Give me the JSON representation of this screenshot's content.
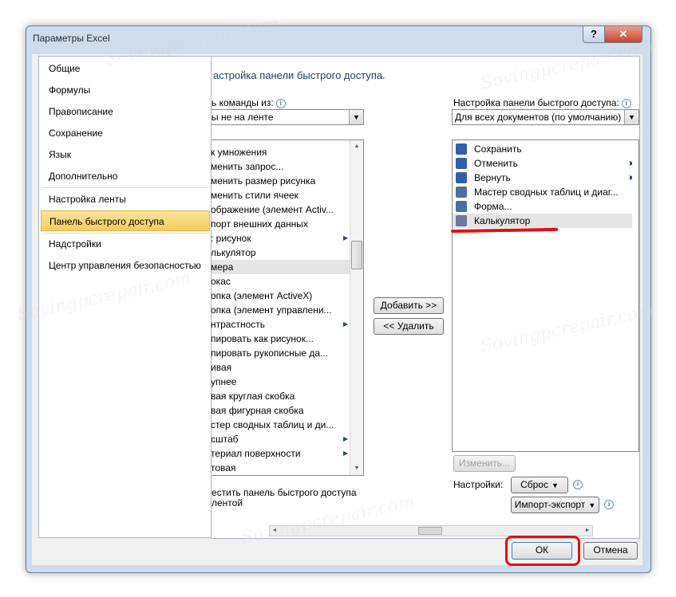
{
  "window": {
    "title": "Параметры Excel",
    "help_label": "?",
    "close_label": "✕"
  },
  "nav": {
    "items": [
      {
        "label": "Общие"
      },
      {
        "label": "Формулы"
      },
      {
        "label": "Правописание"
      },
      {
        "label": "Сохранение"
      },
      {
        "label": "Язык"
      },
      {
        "label": "Дополнительно"
      },
      {
        "label": "Настройка ленты"
      },
      {
        "label": "Панель быстрого доступа",
        "active": true
      },
      {
        "label": "Надстройки"
      },
      {
        "label": "Центр управления безопасностью"
      }
    ]
  },
  "main": {
    "heading": "астройка панели быстрого доступа.",
    "choose_label": "ь команды из:",
    "choose_value": "ы не на ленте",
    "customize_label": "Настройка панели быстрого доступа:",
    "customize_value": "Для всех документов (по умолчанию)",
    "commands": [
      {
        "label": "к умножения"
      },
      {
        "label": "менить запрос..."
      },
      {
        "label": "менить размер рисунка"
      },
      {
        "label": "менить стили ячеек"
      },
      {
        "label": "ображение (элемент Activ..."
      },
      {
        "label": "порт внешних данных"
      },
      {
        "label": ": рисунок",
        "submenu": true
      },
      {
        "label": "лькулятор"
      },
      {
        "label": "мера",
        "selected": true
      },
      {
        "label": "окас"
      },
      {
        "label": "опка (элемент ActiveX)"
      },
      {
        "label": "опка (элемент управлени..."
      },
      {
        "label": "нтрастность",
        "submenu": true
      },
      {
        "label": "пировать как рисунок..."
      },
      {
        "label": "пировать рукописные да..."
      },
      {
        "label": "ивая"
      },
      {
        "label": "упнее"
      },
      {
        "label": "вая круглая скобка"
      },
      {
        "label": "вая фигурная скобка"
      },
      {
        "label": "стер сводных таблиц и ди..."
      },
      {
        "label": "сштаб",
        "submenu": true
      },
      {
        "label": "териал поверхности",
        "submenu": true
      },
      {
        "label": "товая"
      }
    ],
    "qat_items": [
      {
        "label": "Сохранить",
        "icon": "save-icon",
        "color": "#2f5fa8"
      },
      {
        "label": "Отменить",
        "icon": "undo-icon",
        "color": "#2f5fa8",
        "submenu": true
      },
      {
        "label": "Вернуть",
        "icon": "redo-icon",
        "color": "#2f5fa8",
        "submenu": true
      },
      {
        "label": "Мастер сводных таблиц и диаг...",
        "icon": "pivot-wizard-icon",
        "color": "#4a6fa0"
      },
      {
        "label": "Форма...",
        "icon": "form-icon",
        "color": "#4a6fa0"
      },
      {
        "label": "Калькулятор",
        "icon": "calculator-icon",
        "color": "#6c7aa0",
        "selected": true
      }
    ],
    "add_label": "Добавить >>",
    "remove_label": "<< Удалить",
    "modify_label": "Изменить...",
    "settings_label": "Настройки:",
    "reset_label": "Сброс",
    "import_export_label": "Импорт-экспорт",
    "show_below_line1": "естить панель быстрого доступа",
    "show_below_line2": "лентой"
  },
  "footer": {
    "ok_label": "ОК",
    "cancel_label": "Отмена"
  },
  "watermark": "Sovingpcrepair.com",
  "colors": {
    "highlight": "#e21010",
    "nav_active": "#f6cc5c",
    "frame": "#cfdcec"
  }
}
